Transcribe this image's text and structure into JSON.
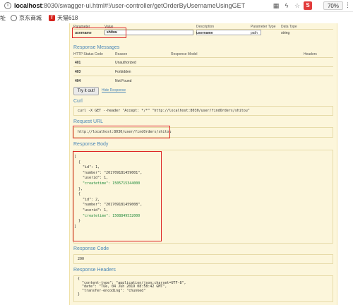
{
  "browser": {
    "url_host": "localhost",
    "url_rest": ":8030/swagger-ui.html#!/user-controller/getOrderByUsernameUsingGET",
    "zoom": "70%",
    "bookmarks": [
      {
        "label": "京东商城"
      },
      {
        "label": "天猫618"
      }
    ],
    "left_cut_label": "址"
  },
  "params": {
    "headers": [
      "Parameter",
      "Value",
      "Description",
      "Parameter Type",
      "Data Type"
    ],
    "row": {
      "name": "username",
      "value": "shitou",
      "description": "username",
      "param_type": "path",
      "data_type": "string"
    }
  },
  "response_messages": {
    "title": "Response Messages",
    "headers": [
      "HTTP Status Code",
      "Reason",
      "Response Model",
      "Headers"
    ],
    "rows": [
      {
        "code": "401",
        "reason": "Unauthorized"
      },
      {
        "code": "403",
        "reason": "Forbidden"
      },
      {
        "code": "404",
        "reason": "Not Found"
      }
    ]
  },
  "actions": {
    "try_label": "Try it out!",
    "hide_label": "Hide Response"
  },
  "curl": {
    "title": "Curl",
    "command": "curl -X GET --header \"Accept: */*\" \"http://localhost:8030/user/findOrders/shitou\""
  },
  "request_url": {
    "title": "Request URL",
    "value": "http://localhost:8030/user/findOrders/shitou"
  },
  "response_body": {
    "title": "Response Body",
    "lines": [
      "[",
      "  {",
      "    \"id\": 1,",
      "    \"number\": \"201709181459001\",",
      "    \"userid\": 1,",
      "    \"createtime\": 1505715344000",
      "  },",
      "  {",
      "    \"id\": 2,",
      "    \"number\": \"201709181459008\",",
      "    \"userid\": 1,",
      "    \"createtime\": 1508849532000",
      "  }",
      "]"
    ]
  },
  "response_code": {
    "title": "Response Code",
    "value": "200"
  },
  "response_headers": {
    "title": "Response Headers",
    "lines": [
      "{",
      "  \"content-type\": \"application/json;charset=UTF-8\",",
      "  \"date\": \"Tue, 04 Jun 2019 08:58:42 GMT\",",
      "  \"transfer-encoding\": \"chunked\"",
      "}"
    ]
  },
  "colors": {
    "section_blue": "#4a87b8",
    "panel_bg": "#fcf6db",
    "highlight_red": "#dd2222",
    "number_green": "#1f8a3b"
  }
}
